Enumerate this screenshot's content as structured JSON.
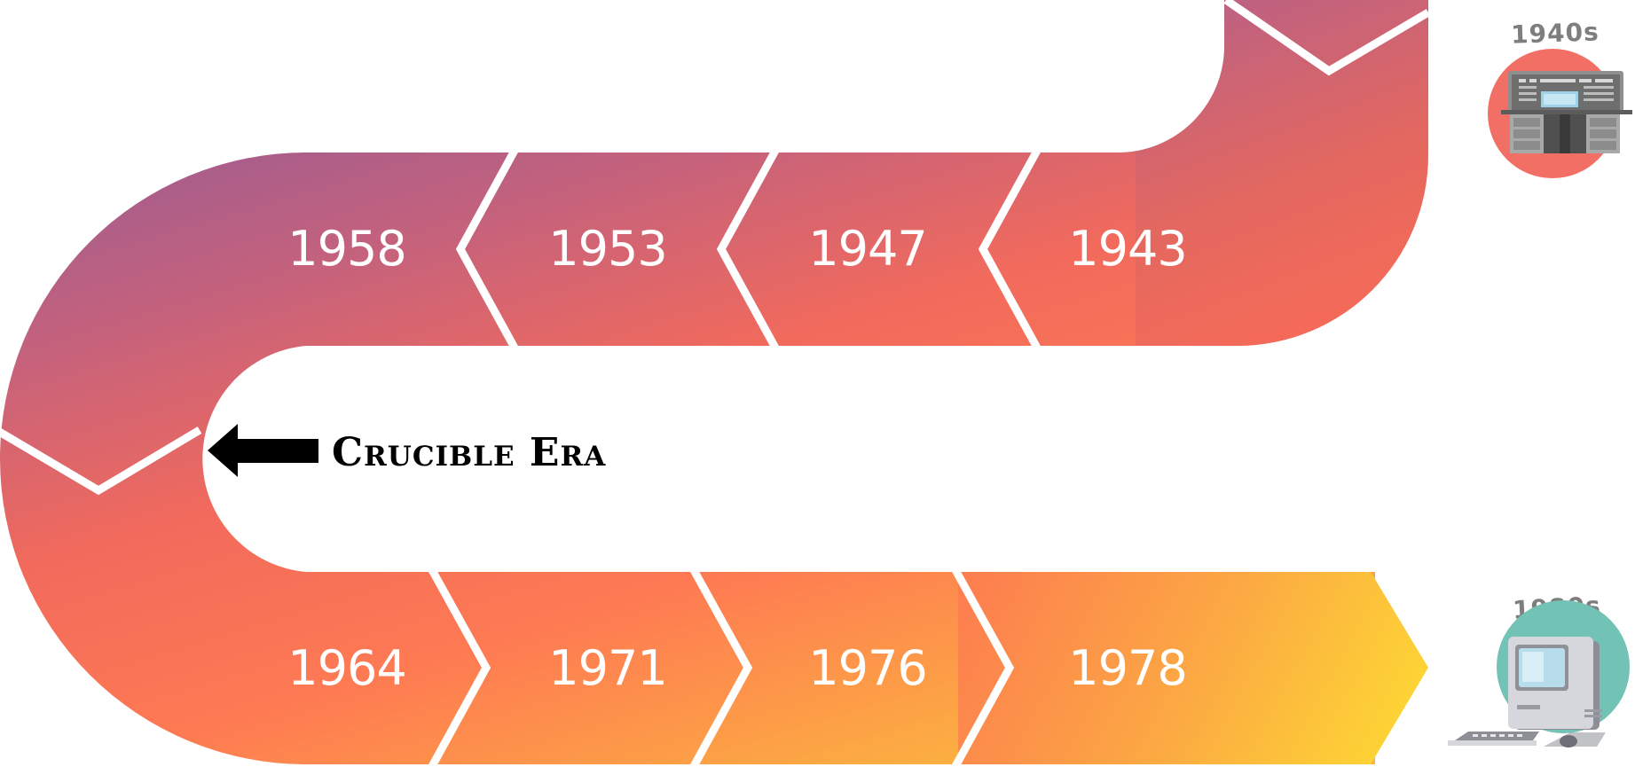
{
  "timeline": {
    "upper_row": [
      "1958",
      "1953",
      "1947",
      "1943"
    ],
    "lower_row": [
      "1964",
      "1971",
      "1976",
      "1978"
    ],
    "annotation": "Crucible Era"
  },
  "icons": {
    "top": {
      "label": "1940s",
      "name": "mainframe-computer-icon"
    },
    "bottom": {
      "label": "1980s",
      "name": "personal-computer-icon"
    }
  },
  "colors": {
    "gradient_purple": "#b0618a",
    "gradient_coral": "#f4695a",
    "gradient_orange": "#fb8a4d",
    "gradient_yellow": "#fdd634",
    "top_circle": "#f26f65",
    "bottom_circle": "#72c2b6"
  }
}
